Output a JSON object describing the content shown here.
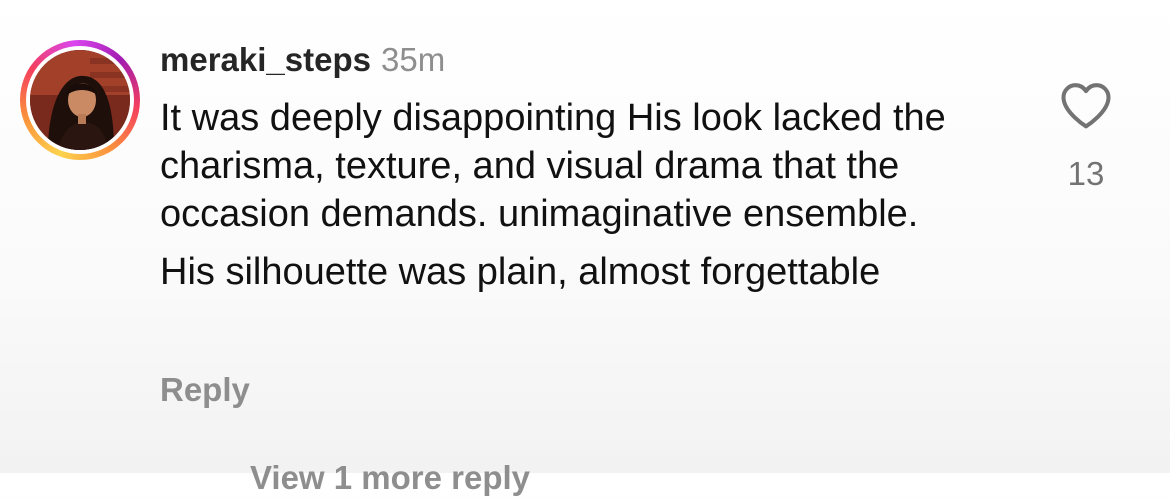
{
  "comment": {
    "username": "meraki_steps",
    "timestamp": "35m",
    "text_paragraphs": [
      "It was deeply disappointing His look lacked the charisma, texture, and visual drama that the occasion demands. unimaginative ensemble.",
      "His silhouette was plain, almost forgettable"
    ],
    "reply_label": "Reply",
    "like_icon": "heart-outline-icon",
    "like_count": "13",
    "view_replies_label": "View 1 more reply"
  },
  "colors": {
    "username": "#262626",
    "muted": "#8e8e8e",
    "avatar_ring": [
      "#fcd34d",
      "#fb923c",
      "#f43f5e",
      "#d946ef"
    ]
  }
}
